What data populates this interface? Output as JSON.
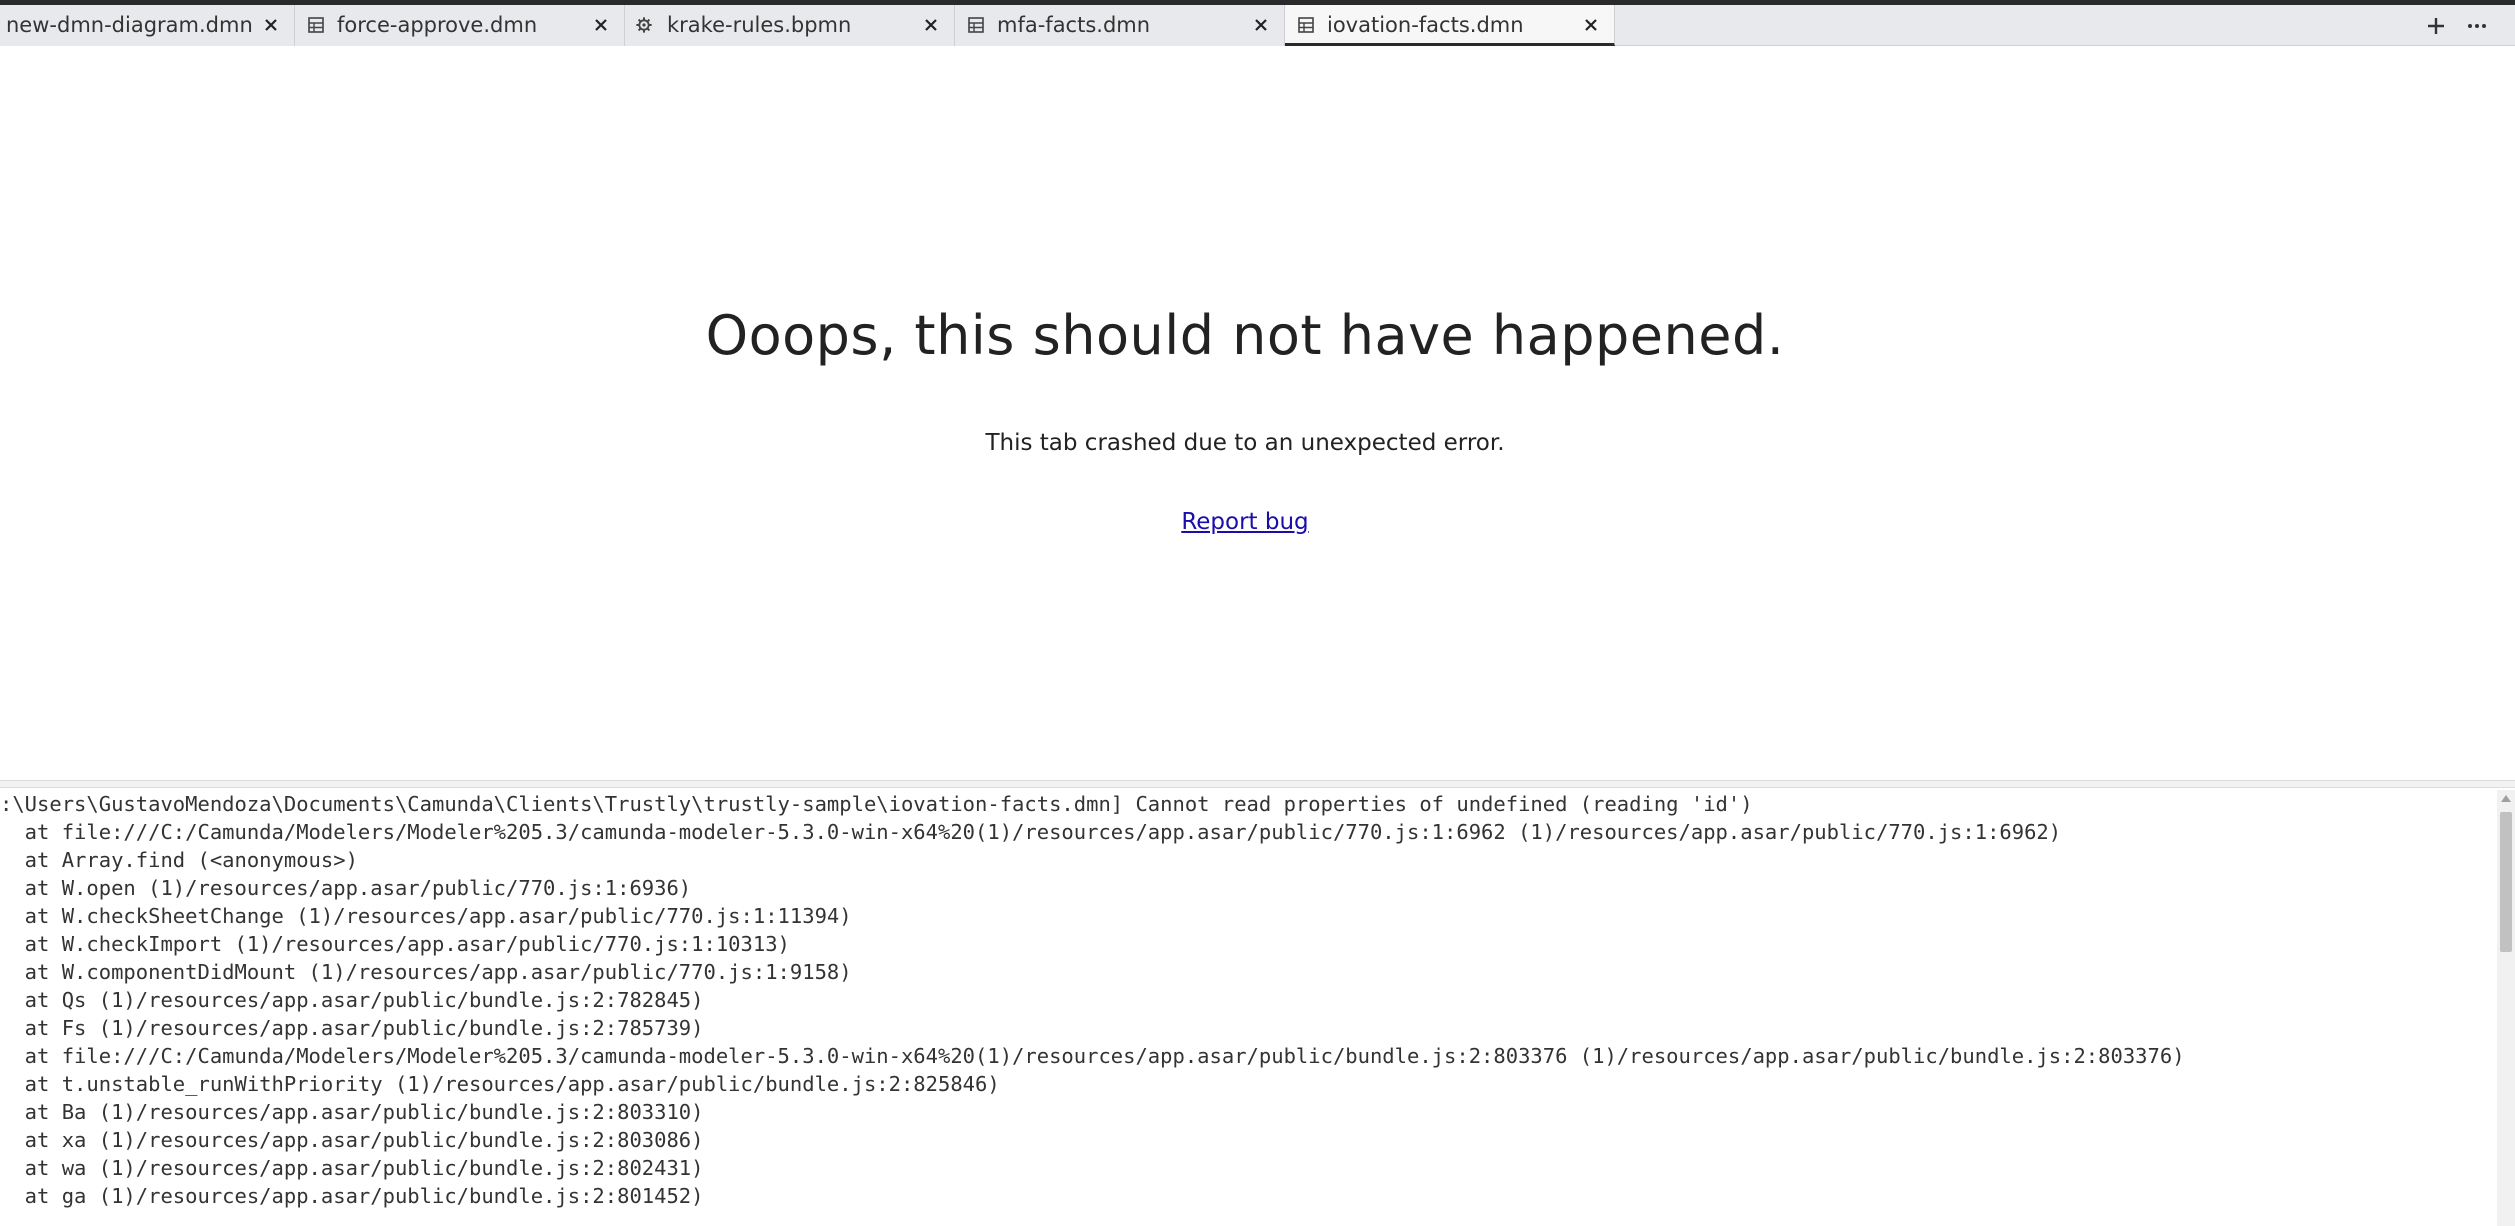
{
  "tabs": [
    {
      "label": "new-dmn-diagram.dmn",
      "icon": "dmn-table-icon",
      "active": false
    },
    {
      "label": "force-approve.dmn",
      "icon": "dmn-table-icon",
      "active": false
    },
    {
      "label": "krake-rules.bpmn",
      "icon": "gear-icon",
      "active": false
    },
    {
      "label": "mfa-facts.dmn",
      "icon": "dmn-table-icon",
      "active": false
    },
    {
      "label": "iovation-facts.dmn",
      "icon": "dmn-table-icon",
      "active": true
    }
  ],
  "tabbar_actions": {
    "add_icon": "plus-icon",
    "more_icon": "ellipsis-icon"
  },
  "crash": {
    "title": "Ooops, this should not have happened.",
    "subtitle": "This tab crashed due to an unexpected error.",
    "report_link": "Report bug"
  },
  "log_lines": [
    ":\\Users\\GustavoMendoza\\Documents\\Camunda\\Clients\\Trustly\\trustly-sample\\iovation-facts.dmn] Cannot read properties of undefined (reading 'id')",
    "  at file:///C:/Camunda/Modelers/Modeler%205.3/camunda-modeler-5.3.0-win-x64%20(1)/resources/app.asar/public/770.js:1:6962 (1)/resources/app.asar/public/770.js:1:6962)",
    "  at Array.find (<anonymous>)",
    "  at W.open (1)/resources/app.asar/public/770.js:1:6936)",
    "  at W.checkSheetChange (1)/resources/app.asar/public/770.js:1:11394)",
    "  at W.checkImport (1)/resources/app.asar/public/770.js:1:10313)",
    "  at W.componentDidMount (1)/resources/app.asar/public/770.js:1:9158)",
    "  at Qs (1)/resources/app.asar/public/bundle.js:2:782845)",
    "  at Fs (1)/resources/app.asar/public/bundle.js:2:785739)",
    "  at file:///C:/Camunda/Modelers/Modeler%205.3/camunda-modeler-5.3.0-win-x64%20(1)/resources/app.asar/public/bundle.js:2:803376 (1)/resources/app.asar/public/bundle.js:2:803376)",
    "  at t.unstable_runWithPriority (1)/resources/app.asar/public/bundle.js:2:825846)",
    "  at Ba (1)/resources/app.asar/public/bundle.js:2:803310)",
    "  at xa (1)/resources/app.asar/public/bundle.js:2:803086)",
    "  at wa (1)/resources/app.asar/public/bundle.js:2:802431)",
    "  at ga (1)/resources/app.asar/public/bundle.js:2:801452)"
  ]
}
